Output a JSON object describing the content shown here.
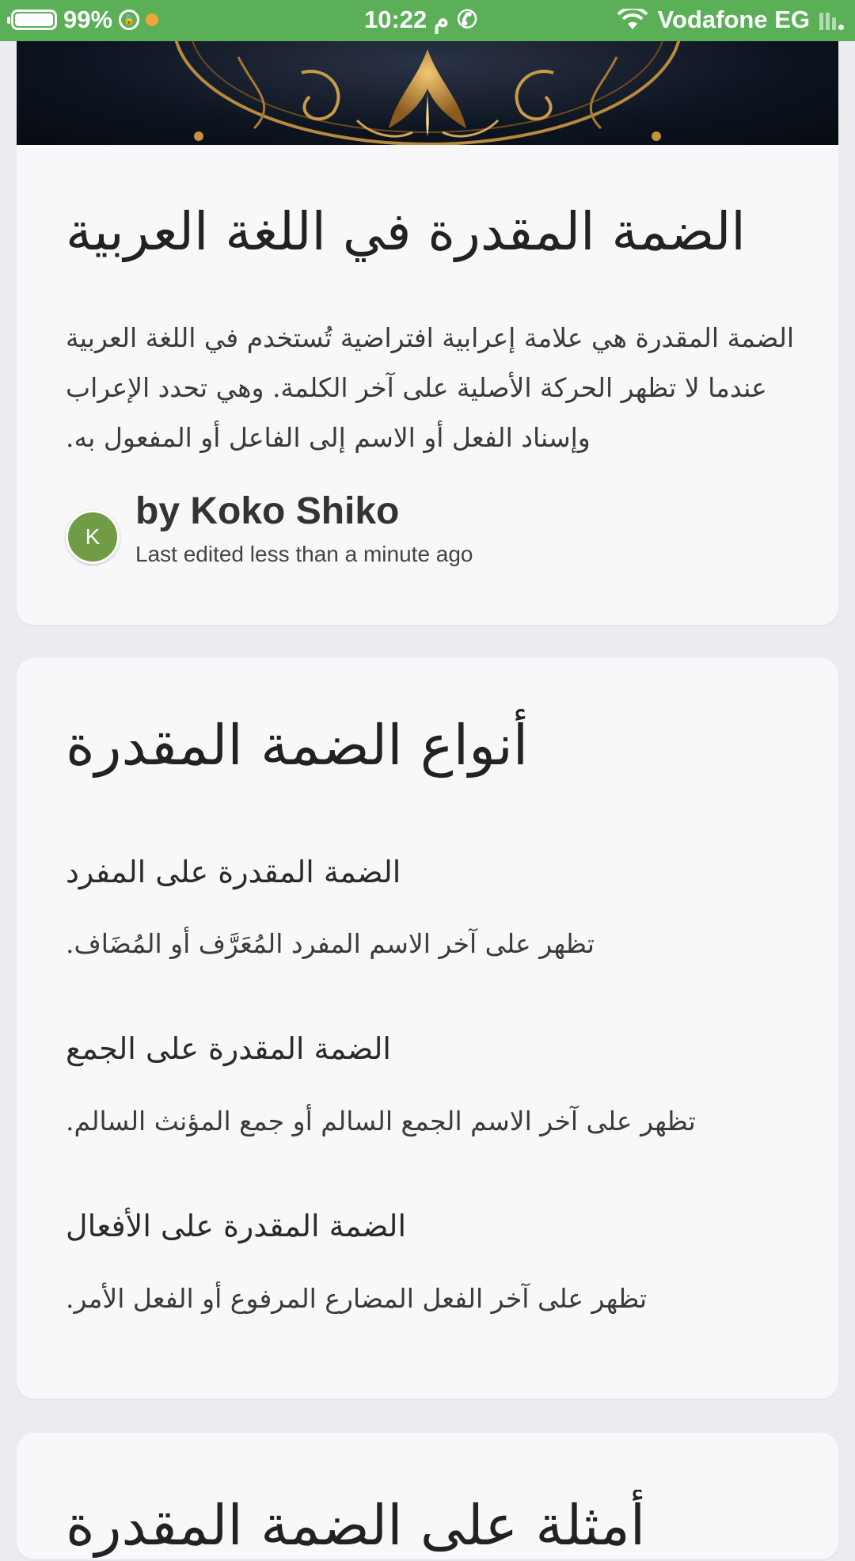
{
  "status_bar": {
    "battery": "99%",
    "time": "10:22 م",
    "carrier": "Vodafone EG",
    "accent_color": "#5aaf57"
  },
  "document": {
    "title": "الضمة المقدرة في اللغة العربية",
    "description": "الضمة المقدرة هي علامة إعرابية افتراضية تُستخدم في اللغة العربية عندما لا تظهر الحركة الأصلية على آخر الكلمة. وهي تحدد الإعراب وإسناد الفعل أو الاسم إلى الفاعل أو المفعول به.",
    "author_initial": "K",
    "author": "by Koko Shiko",
    "edited": "Last edited less than a minute ago",
    "avatar_color": "#6f9c45"
  },
  "section": {
    "title": "أنواع الضمة المقدرة",
    "items": [
      {
        "heading": "الضمة المقدرة على المفرد",
        "text": "تظهر على آخر الاسم المفرد المُعَرَّف أو المُضَاف."
      },
      {
        "heading": "الضمة المقدرة على الجمع",
        "text": "تظهر على آخر الاسم الجمع السالم أو جمع المؤنث السالم."
      },
      {
        "heading": "الضمة المقدرة على الأفعال",
        "text": "تظهر على آخر الفعل المضارع المرفوع أو الفعل الأمر."
      }
    ]
  },
  "next_section": {
    "title": "أمثلة على الضمة المقدرة"
  }
}
